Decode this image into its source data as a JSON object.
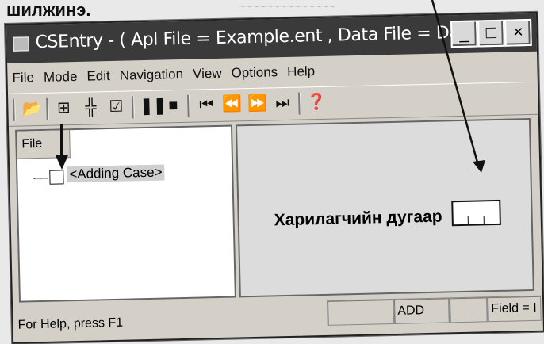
{
  "caption": {
    "text": "шилжинэ."
  },
  "window": {
    "title": "CSEntry - ( Apl File = Example.ent , Data File = Data_nan...",
    "controls": {
      "minimize": "_",
      "maximize": "□",
      "close": "×"
    }
  },
  "menu": [
    "File",
    "Mode",
    "Edit",
    "Navigation",
    "View",
    "Options",
    "Help"
  ],
  "left_pane": {
    "tab_label": "File",
    "case_label": "<Adding Case>"
  },
  "right_pane": {
    "field_label": "Харилагчийн дугаар"
  },
  "statusbar": {
    "help": "For Help, press F1",
    "mode": "ADD",
    "field": "Field = I"
  }
}
